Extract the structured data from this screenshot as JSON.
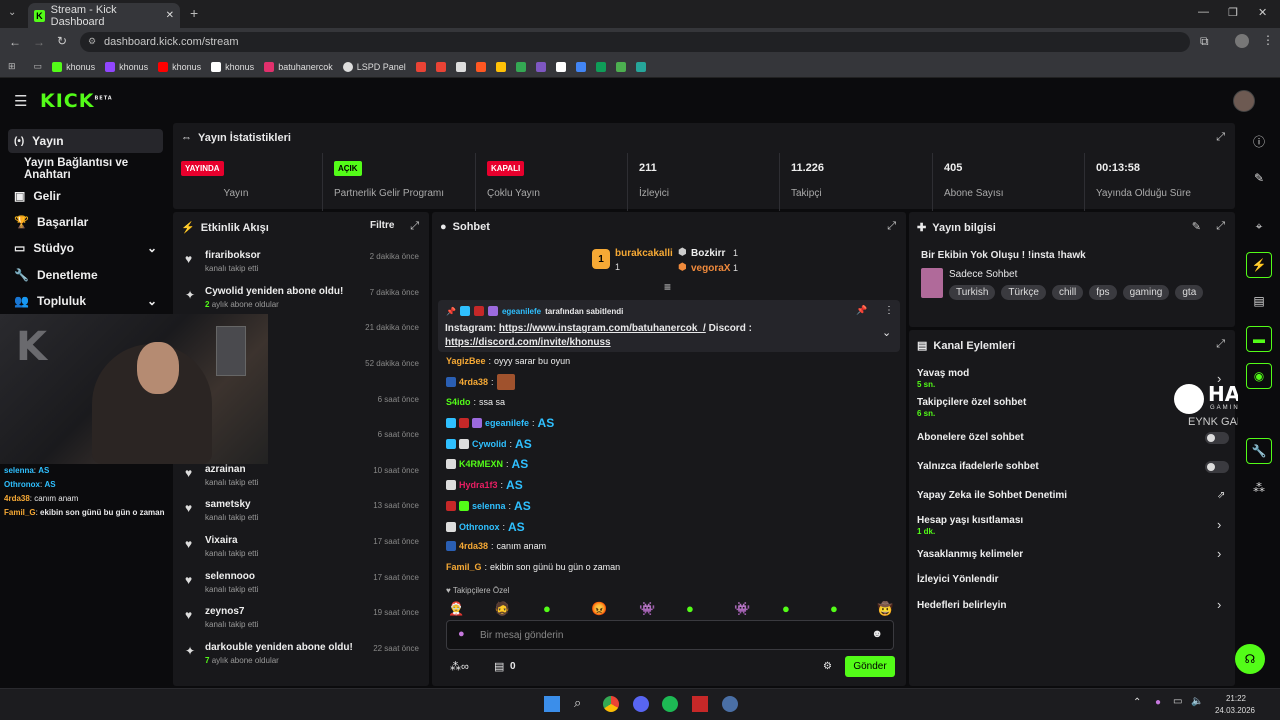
{
  "browser": {
    "tab_title": "Stream - Kick Dashboard",
    "url": "dashboard.kick.com/stream",
    "bookmarks": [
      {
        "label": "khonus",
        "color": "#53fc18"
      },
      {
        "label": "khonus",
        "color": "#9146ff"
      },
      {
        "label": "khonus",
        "color": "#ff0000"
      },
      {
        "label": "khonus",
        "color": "#ffffff"
      },
      {
        "label": "batuhanercok",
        "color": "#e1306c"
      },
      {
        "label": "LSPD Panel",
        "color": "#dddddd"
      }
    ]
  },
  "app": {
    "logo": "KICK",
    "logo_sup": "BETA",
    "accent": "#53fc18"
  },
  "sidebar": {
    "items": [
      {
        "label": "Yayın",
        "icon": "broadcast-icon"
      },
      {
        "label": "Yayın Bağlantısı ve Anahtarı",
        "icon": ""
      },
      {
        "label": "Gelir",
        "icon": "money-icon"
      },
      {
        "label": "Başarılar",
        "icon": "trophy-icon"
      },
      {
        "label": "Stüdyo",
        "icon": "studio-icon"
      },
      {
        "label": "Denetleme",
        "icon": "wrench-icon"
      },
      {
        "label": "Topluluk",
        "icon": "people-icon"
      }
    ]
  },
  "stats": {
    "title": "Yayın İstatistikleri",
    "items": [
      {
        "badge": "YAYINDA",
        "badge_color": "#e8002d",
        "label": "Yayın"
      },
      {
        "badge": "AÇIK",
        "badge_color": "#53fc18",
        "label": "Partnerlik Gelir Programı"
      },
      {
        "badge": "KAPALI",
        "badge_color": "#e8002d",
        "label": "Çoklu Yayın"
      },
      {
        "value": "211",
        "label": "İzleyici"
      },
      {
        "value": "11.226",
        "label": "Takipçi"
      },
      {
        "value": "405",
        "label": "Abone Sayısı"
      },
      {
        "value": "00:13:58",
        "label": "Yayında Olduğu Süre"
      }
    ]
  },
  "activity": {
    "title": "Etkinlik Akışı",
    "filter": "Filtre",
    "items": [
      {
        "name": "firariboksor",
        "sub": "kanalı takip etti",
        "time": "2 dakika önce",
        "icon": "heart-icon"
      },
      {
        "name": "Cywolid yeniden abone oldu!",
        "sub_prefix": "2",
        "sub": "aylık abone oldular",
        "time": "7 dakika önce",
        "icon": "sparkle-icon"
      },
      {
        "name": "",
        "sub": "",
        "time": "21 dakika önce",
        "icon": ""
      },
      {
        "name": "",
        "sub": "",
        "time": "52 dakika önce",
        "icon": ""
      },
      {
        "name": "",
        "sub": "",
        "time": "6 saat önce",
        "icon": ""
      },
      {
        "name": "",
        "sub": "",
        "time": "6 saat önce",
        "icon": ""
      },
      {
        "name": "azrainan",
        "sub": "kanalı takip etti",
        "time": "10 saat önce",
        "icon": "heart-icon"
      },
      {
        "name": "sametsky",
        "sub": "kanalı takip etti",
        "time": "13 saat önce",
        "icon": "heart-icon"
      },
      {
        "name": "Vixaira",
        "sub": "kanalı takip etti",
        "time": "17 saat önce",
        "icon": "heart-icon"
      },
      {
        "name": "selennooo",
        "sub": "kanalı takip etti",
        "time": "17 saat önce",
        "icon": "heart-icon"
      },
      {
        "name": "zeynos7",
        "sub": "kanalı takip etti",
        "time": "19 saat önce",
        "icon": "heart-icon"
      },
      {
        "name": "darkouble yeniden abone oldu!",
        "sub_prefix": "7",
        "sub": "aylık abone oldular",
        "time": "22 saat önce",
        "icon": "sparkle-icon"
      }
    ]
  },
  "overlay_chat": [
    {
      "user": "selenna",
      "user_color": "#2fc0ff",
      "msg": "AS"
    },
    {
      "user": "Othronox",
      "user_color": "#2fc0ff",
      "msg": "AS"
    },
    {
      "user": "4rda38",
      "user_color": "#f6a935",
      "msg": "canım anam"
    },
    {
      "user": "Famil_G",
      "user_color": "#f6a935",
      "msg": "ekibin son günü bu gün o zaman"
    }
  ],
  "chat": {
    "title": "Sohbet",
    "leaders": [
      {
        "name": "burakcakalli",
        "count": "1"
      },
      {
        "name": "Bozkirr",
        "count": "1"
      },
      {
        "name": "vegoraX",
        "count": "1"
      }
    ],
    "pinned_by": "egeanilefe",
    "pinned_suffix": "tarafından sabitlendi",
    "pinned_text": "Instagram: ",
    "pinned_link1": "https://www.instagram.com/batuhanercok_/",
    "pinned_mid": " Discord : ",
    "pinned_link2": "https://discord.com/invite/khonuss",
    "messages": [
      {
        "user": "YagizBee",
        "color": "#f6a935",
        "text": "oyyy sarar bu oyun"
      },
      {
        "user": "4rda38",
        "color": "#f6a935",
        "text": ""
      },
      {
        "user": "S4ido",
        "color": "#53fc18",
        "text": "ssa sa"
      },
      {
        "user": "egeanilefe",
        "color": "#2fc0ff",
        "text": "AS"
      },
      {
        "user": "Cywolid",
        "color": "#2fc0ff",
        "text": "AS"
      },
      {
        "user": "K4RMEXN",
        "color": "#53fc18",
        "text": "AS"
      },
      {
        "user": "Hydra1f3",
        "color": "#e91e63",
        "text": "AS"
      },
      {
        "user": "selenna",
        "color": "#2fc0ff",
        "text": "AS"
      },
      {
        "user": "Othronox",
        "color": "#2fc0ff",
        "text": "AS"
      },
      {
        "user": "4rda38",
        "color": "#f6a935",
        "text": "canım anam"
      },
      {
        "user": "Famil_G",
        "color": "#f6a935",
        "text": "ekibin son günü bu gün o zaman"
      }
    ],
    "emote_section": "Takipçilere Özel",
    "input_placeholder": "Bir mesaj gönderin",
    "points": "0",
    "send": "Gönder"
  },
  "stream_info": {
    "title": "Yayın bilgisi",
    "stream_title": "Bir Ekibin Yok Oluşu ! !insta !hawk",
    "category": "Sadece Sohbet",
    "tags": [
      "Turkish",
      "Türkçe",
      "chill",
      "fps",
      "gaming",
      "gta"
    ]
  },
  "channel_actions": {
    "title": "Kanal Eylemleri",
    "items": [
      {
        "label": "Yavaş mod",
        "sub": "5 sn.",
        "type": "chevron"
      },
      {
        "label": "Takipçilere özel sohbet",
        "sub": "6 sn.",
        "type": "none"
      },
      {
        "label": "Abonelere özel sohbet",
        "sub": "",
        "type": "toggle"
      },
      {
        "label": "Yalnızca ifadelerle sohbet",
        "sub": "",
        "type": "toggle"
      },
      {
        "label": "Yapay Zeka ile Sohbet Denetimi",
        "sub": "",
        "type": "external"
      },
      {
        "label": "Hesap yaşı kısıtlaması",
        "sub": "1 dk.",
        "type": "chevron"
      },
      {
        "label": "Yasaklanmış kelimeler",
        "sub": "",
        "type": "chevron"
      },
      {
        "label": "İzleyici Yönlendir",
        "sub": "",
        "type": "none"
      },
      {
        "label": "Hedefleri belirleyin",
        "sub": "",
        "type": "chevron"
      }
    ]
  },
  "watermark": {
    "brand": "HAWK",
    "sub1": "GAMING",
    "sub2": "EYNK GAME"
  },
  "taskbar": {
    "time": "21:22",
    "date": "24.03.2026"
  }
}
